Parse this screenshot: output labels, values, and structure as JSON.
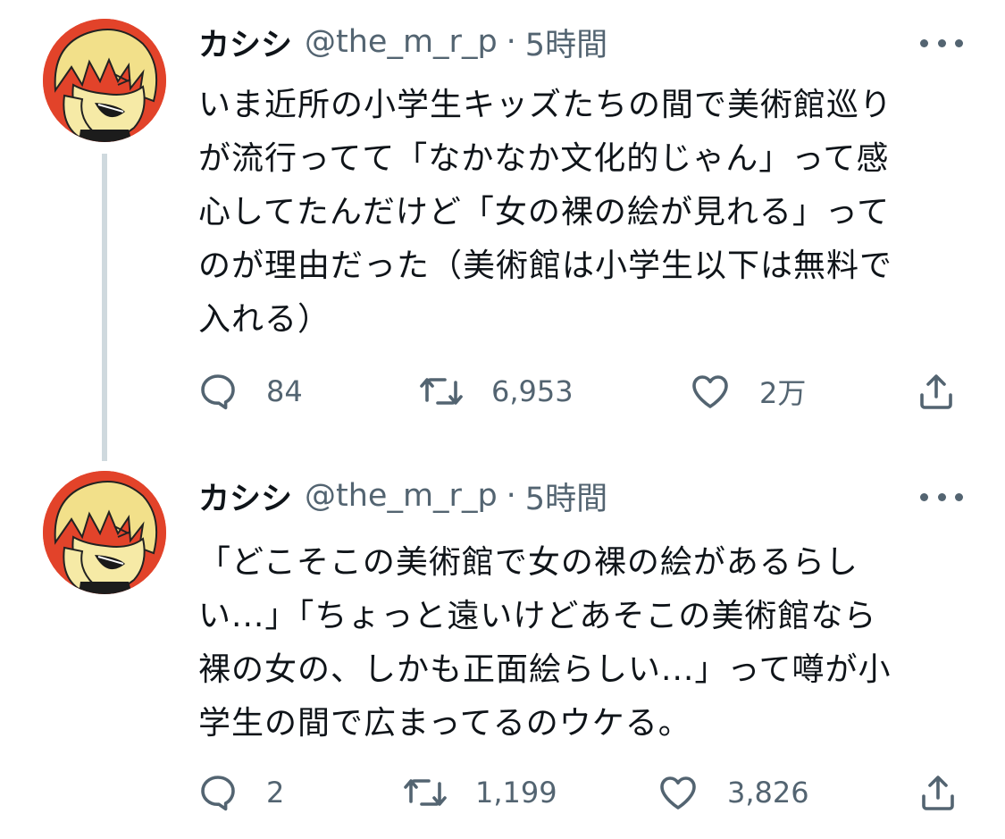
{
  "tweets": [
    {
      "display_name": "カシシ",
      "handle": "@the_m_r_p",
      "separator": "·",
      "time": "5時間",
      "text": "いま近所の小学生キッズたちの間で美術館巡り\nが流行ってて「なかなか文化的じゃん」って感\n心してたんだけど「女の裸の絵が見れる」って\nのが理由だった（美術館は小学生以下は無料で\n入れる）",
      "replies": "84",
      "retweets": "6,953",
      "likes": "2万"
    },
    {
      "display_name": "カシシ",
      "handle": "@the_m_r_p",
      "separator": "·",
      "time": "5時間",
      "text": "「どこそこの美術館で女の裸の絵があるらし\nい...」「ちょっと遠いけどあそこの美術館なら\n裸の女の、しかも正面絵らしい...」って噂が小\n学生の間で広まってるのウケる。",
      "replies": "2",
      "retweets": "1,199",
      "likes": "3,826"
    }
  ],
  "icons": {
    "reply": "speech-bubble-icon",
    "retweet": "retweet-arrows-icon",
    "like": "heart-icon",
    "share": "share-upload-icon",
    "more": "ellipsis-icon"
  },
  "colors": {
    "text": "#0f1419",
    "secondary": "#536471",
    "thread_line": "#cfd9de",
    "avatar_bg": "#e2432a",
    "avatar_hair": "#f2e08a"
  }
}
